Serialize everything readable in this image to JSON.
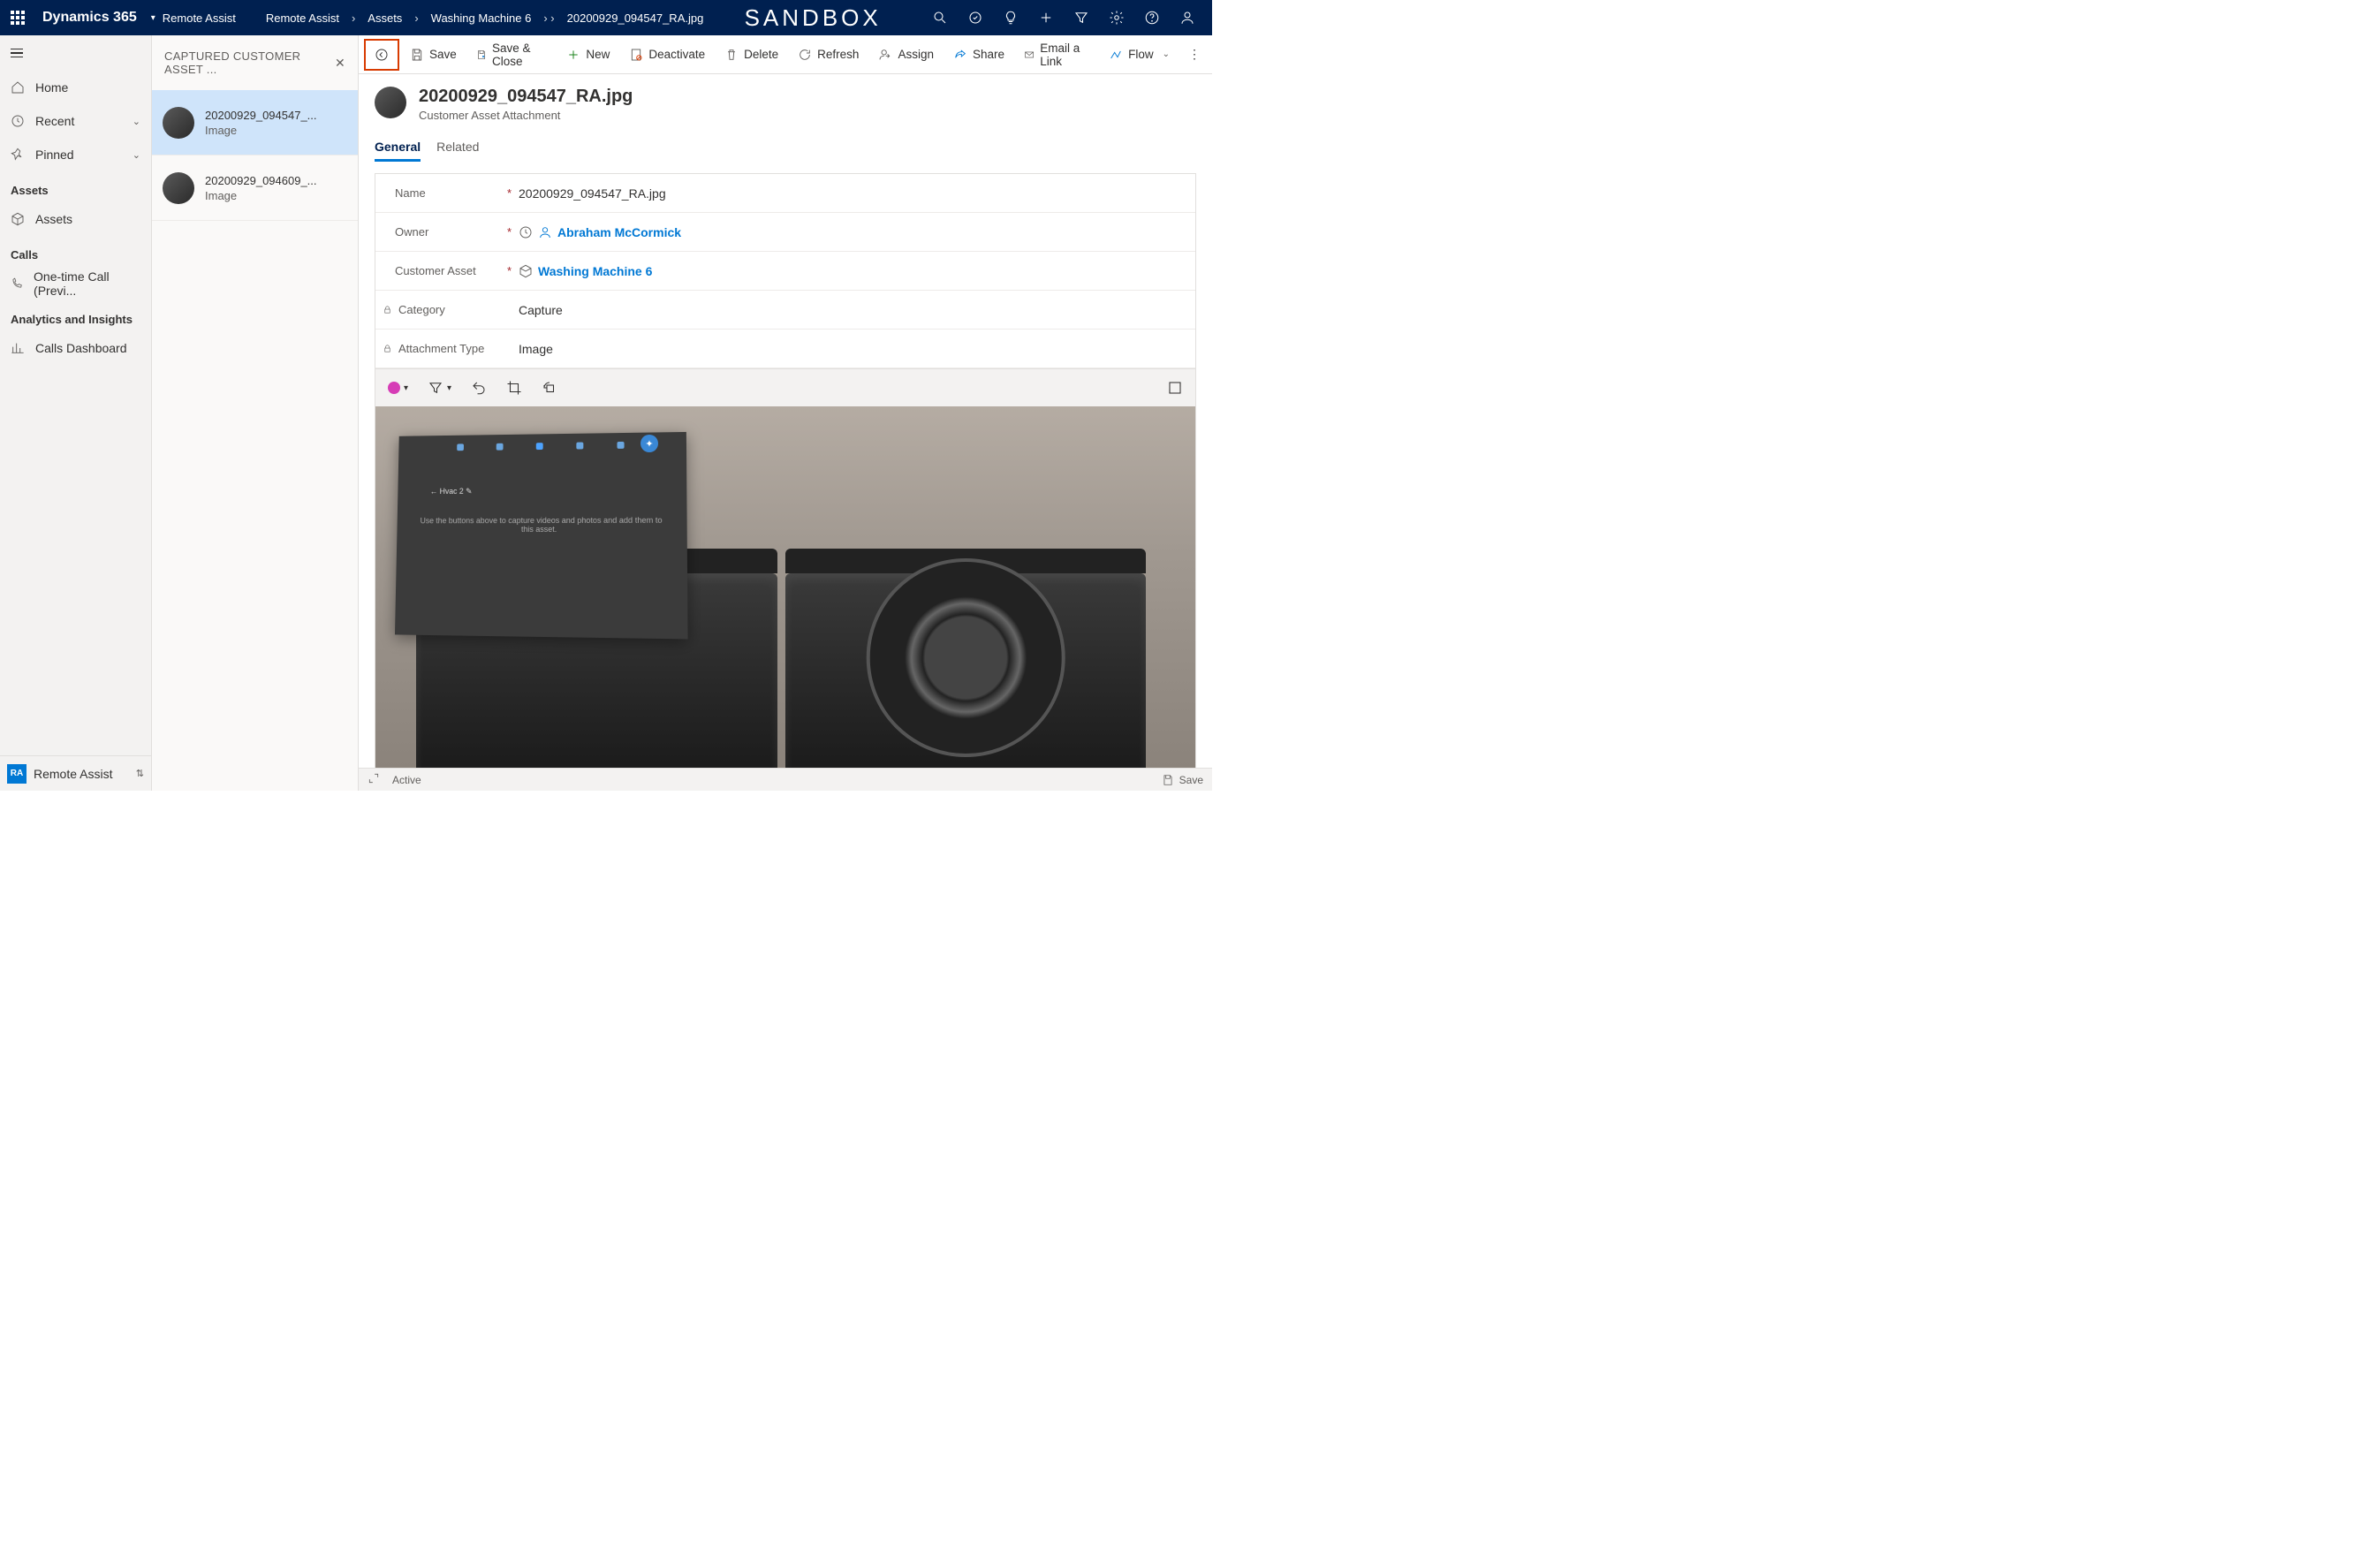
{
  "header": {
    "app_title": "Dynamics 365",
    "sandbox_label": "SANDBOX",
    "breadcrumb": [
      "Remote Assist",
      "Remote Assist",
      "Assets",
      "Washing Machine 6",
      "20200929_094547_RA.jpg"
    ]
  },
  "nav": {
    "home": "Home",
    "recent": "Recent",
    "pinned": "Pinned",
    "sections": {
      "assets": {
        "title": "Assets",
        "items": [
          "Assets"
        ]
      },
      "calls": {
        "title": "Calls",
        "items": [
          "One-time Call (Previ..."
        ]
      },
      "analytics": {
        "title": "Analytics and Insights",
        "items": [
          "Calls Dashboard"
        ]
      }
    },
    "app_switcher": {
      "badge": "RA",
      "label": "Remote Assist"
    }
  },
  "list_panel": {
    "title": "CAPTURED CUSTOMER ASSET ...",
    "items": [
      {
        "title": "20200929_094547_...",
        "sub": "Image"
      },
      {
        "title": "20200929_094609_...",
        "sub": "Image"
      }
    ],
    "selected_index": 0
  },
  "commands": {
    "save": "Save",
    "save_close": "Save & Close",
    "new": "New",
    "deactivate": "Deactivate",
    "delete": "Delete",
    "refresh": "Refresh",
    "assign": "Assign",
    "share": "Share",
    "email_link": "Email a Link",
    "flow": "Flow"
  },
  "record": {
    "title": "20200929_094547_RA.jpg",
    "subtitle": "Customer Asset Attachment",
    "tabs": {
      "general": "General",
      "related": "Related"
    },
    "fields": {
      "name": {
        "label": "Name",
        "value": "20200929_094547_RA.jpg"
      },
      "owner": {
        "label": "Owner",
        "value": "Abraham McCormick"
      },
      "customer_asset": {
        "label": "Customer Asset",
        "value": "Washing Machine 6"
      },
      "category": {
        "label": "Category",
        "value": "Capture"
      },
      "attachment_type": {
        "label": "Attachment Type",
        "value": "Image"
      }
    },
    "image_hint": "Use the buttons above to capture videos and photos and add them to this asset.",
    "panel_title": "Hvac 2"
  },
  "status_bar": {
    "status": "Active",
    "save": "Save"
  }
}
